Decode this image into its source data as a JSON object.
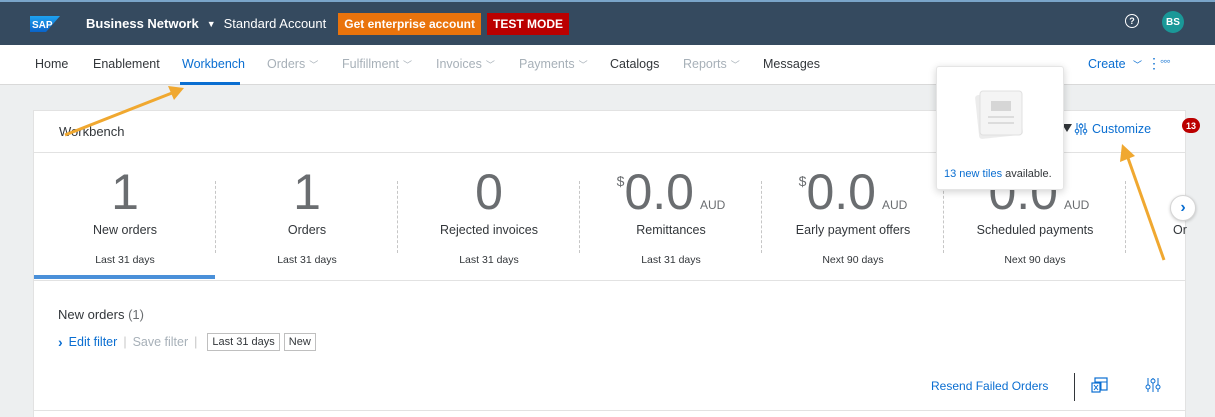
{
  "shell": {
    "logo_text": "SAP",
    "brand": "Business Network",
    "account": "Standard Account",
    "enterprise_button": "Get enterprise account",
    "test_mode": "TEST MODE",
    "help_icon": "help-icon",
    "avatar_initials": "BS"
  },
  "nav": {
    "items": [
      {
        "label": "Home"
      },
      {
        "label": "Enablement"
      },
      {
        "label": "Workbench"
      },
      {
        "label": "Orders"
      },
      {
        "label": "Fulfillment"
      },
      {
        "label": "Invoices"
      },
      {
        "label": "Payments"
      },
      {
        "label": "Catalogs"
      },
      {
        "label": "Reports"
      },
      {
        "label": "Messages"
      }
    ],
    "create_label": "Create"
  },
  "card": {
    "title": "Workbench",
    "customize_label": "Customize",
    "customize_badge": "13"
  },
  "tiles": [
    {
      "value": "1",
      "label": "New orders",
      "period": "Last 31 days"
    },
    {
      "value": "1",
      "label": "Orders",
      "period": "Last 31 days"
    },
    {
      "value": "0",
      "label": "Rejected invoices",
      "period": "Last 31 days"
    },
    {
      "currency": "$",
      "value": "0.0",
      "unit": "AUD",
      "label": "Remittances",
      "period": "Last 31 days"
    },
    {
      "currency": "$",
      "value": "0.0",
      "unit": "AUD",
      "label": "Early payment offers",
      "period": "Next 90 days"
    },
    {
      "currency": "$",
      "value": "0.0",
      "unit": "AUD",
      "label": "Scheduled payments",
      "period": "Next 90 days"
    }
  ],
  "partial_tile_label": "Or",
  "popover": {
    "link_text": "13 new tiles",
    "suffix_text": " available."
  },
  "orders": {
    "title": "New orders",
    "count": "(1)",
    "edit_filter": "Edit filter",
    "save_filter": "Save filter",
    "chips": [
      "Last 31 days",
      "New"
    ],
    "resend_label": "Resend Failed Orders"
  },
  "colors": {
    "shell_bg": "#354a5f",
    "accent": "#0a6ed1",
    "enterprise": "#e9730c",
    "test_mode": "#bb0000",
    "annotation_arrow": "#f0a830"
  }
}
